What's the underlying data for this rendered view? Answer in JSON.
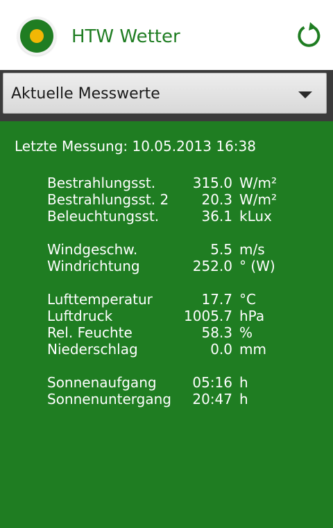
{
  "app": {
    "title": "HTW Wetter"
  },
  "icons": {
    "logo": "htw-logo-icon",
    "refresh": "refresh-icon",
    "dropdown": "chevron-down-icon"
  },
  "colors": {
    "primary_green": "#1f7d22",
    "logo_yellow": "#f2b705",
    "app_bar_bg": "#ffffff",
    "spinner_bar_bg": "#3b3b3b"
  },
  "selector": {
    "selected": "Aktuelle Messwerte"
  },
  "last_measurement": "Letzte Messung: 10.05.2013 16:38",
  "measurements": [
    {
      "label": "Bestrahlungsst.",
      "value": "315.0",
      "unit": "W/m²"
    },
    {
      "label": "Bestrahlungsst. 2",
      "value": "20.3",
      "unit": "W/m²"
    },
    {
      "label": "Beleuchtungsst.",
      "value": "36.1",
      "unit": "kLux"
    },
    {
      "label": "Windgeschw.",
      "value": "5.5",
      "unit": "m/s"
    },
    {
      "label": "Windrichtung",
      "value": "252.0",
      "unit": "° (W)"
    },
    {
      "label": "Lufttemperatur",
      "value": "17.7",
      "unit": "°C"
    },
    {
      "label": "Luftdruck",
      "value": "1005.7",
      "unit": "hPa"
    },
    {
      "label": "Rel. Feuchte",
      "value": "58.3",
      "unit": "%"
    },
    {
      "label": "Niederschlag",
      "value": "0.0",
      "unit": "mm"
    },
    {
      "label": "Sonnenaufgang",
      "value": "05:16",
      "unit": "h"
    },
    {
      "label": "Sonnenuntergang",
      "value": "20:47",
      "unit": "h"
    }
  ]
}
